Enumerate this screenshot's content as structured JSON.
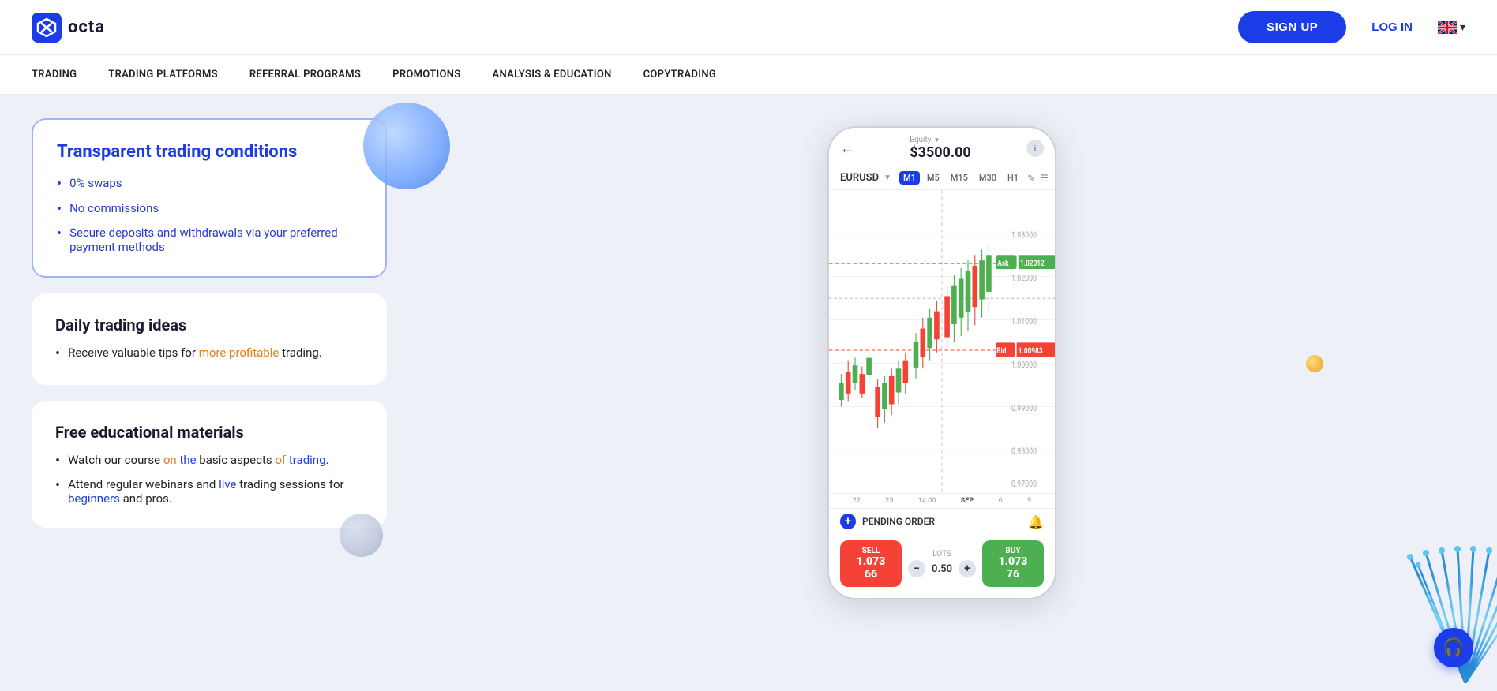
{
  "header": {
    "logo_text": "octa",
    "signup_label": "SIGN UP",
    "login_label": "LOG IN",
    "lang": "EN"
  },
  "nav": {
    "items": [
      {
        "label": "TRADING"
      },
      {
        "label": "TRADING PLATFORMS"
      },
      {
        "label": "REFERRAL PROGRAMS"
      },
      {
        "label": "PROMOTIONS"
      },
      {
        "label": "ANALYSIS & EDUCATION"
      },
      {
        "label": "COPYTRADING"
      }
    ]
  },
  "cards": {
    "card1": {
      "title": "Transparent trading conditions",
      "bullets": [
        "0% swaps",
        "No commissions",
        "Secure deposits and withdrawals via your preferred payment methods"
      ]
    },
    "card2": {
      "title": "Daily trading ideas",
      "bullets": [
        "Receive valuable tips for more profitable trading."
      ]
    },
    "card3": {
      "title": "Free educational materials",
      "bullets": [
        "Watch our course on the basic aspects of trading.",
        "Attend regular webinars and live trading sessions for beginners and pros."
      ]
    }
  },
  "phone": {
    "equity_label": "Equity",
    "equity_value": "$3500.00",
    "pair": "EURUSD",
    "timeframes": [
      "M1",
      "M5",
      "M15",
      "M30",
      "H1"
    ],
    "active_tf": "M1",
    "ask_label": "Ask",
    "ask_value": "1.02012",
    "bid_label": "Bid",
    "bid_value": "1.00983",
    "y_labels": [
      "1.03000",
      "1.02000",
      "1.01000",
      "1.00000",
      "0.99000",
      "0.98000",
      "0.97000"
    ],
    "x_labels": [
      "22",
      "25",
      "14:00",
      "SEP",
      "6",
      "9"
    ],
    "pending_label": "PENDING ORDER",
    "lots_label": "LOTS",
    "lots_value": "0.50",
    "sell_label": "SELL",
    "sell_price": "1.073 66",
    "buy_label": "BUY",
    "buy_price": "1.073 76"
  },
  "chat_btn": {
    "label": "Chat support"
  }
}
